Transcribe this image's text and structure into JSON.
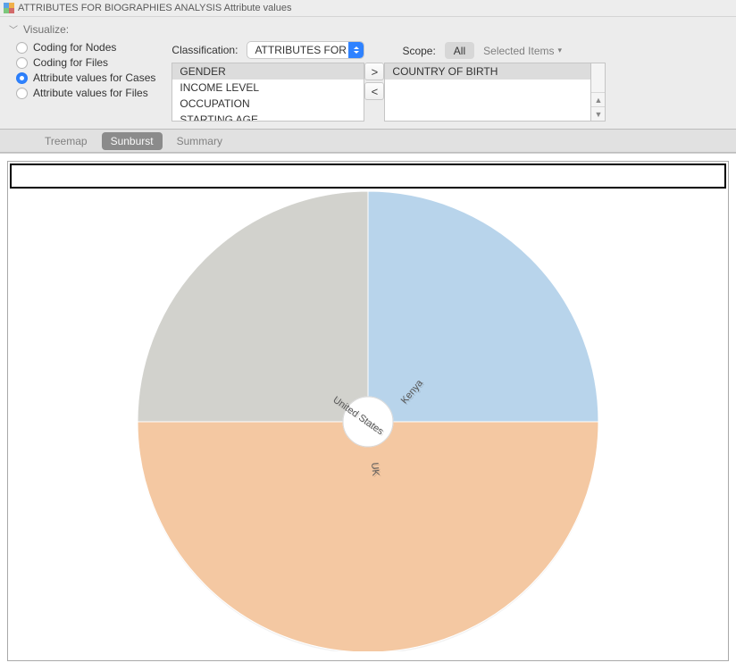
{
  "title": "ATTRIBUTES FOR BIOGRAPHIES ANALYSIS Attribute values",
  "visualize_label": "Visualize:",
  "radio_options": {
    "coding_nodes": "Coding for Nodes",
    "coding_files": "Coding for Files",
    "attr_cases": "Attribute values for Cases",
    "attr_files": "Attribute values for Files"
  },
  "radio_selected": "attr_cases",
  "classification_label": "Classification:",
  "classification_value": "ATTRIBUTES FOR B...",
  "attribute_list": [
    "GENDER",
    "INCOME LEVEL",
    "OCCUPATION",
    "STARTING AGE"
  ],
  "attribute_selected": "GENDER",
  "transfer_right": ">",
  "transfer_left": "<",
  "selected_attributes": [
    "COUNTRY OF BIRTH"
  ],
  "selected_attr_highlight": "COUNTRY OF BIRTH",
  "scope_label": "Scope:",
  "scope_all": "All",
  "scope_selected_items": "Selected Items",
  "tabs": {
    "treemap": "Treemap",
    "sunburst": "Sunburst",
    "summary": "Summary"
  },
  "active_tab": "sunburst",
  "chart_data": {
    "type": "pie",
    "title": "",
    "slices": [
      {
        "label": "Kenya",
        "value": 25,
        "color": "#b8d4eb",
        "startAngle": 0,
        "endAngle": 90,
        "labelAngle": 65,
        "labelRot": -50
      },
      {
        "label": "UK",
        "value": 50,
        "color": "#f4c8a2",
        "startAngle": 90,
        "endAngle": 270,
        "labelAngle": 175,
        "labelRot": 85
      },
      {
        "label": "United States",
        "value": 25,
        "color": "#d2d2cd",
        "startAngle": 270,
        "endAngle": 360,
        "labelAngle": 300,
        "labelRot": 35
      }
    ],
    "innerRadius": 28,
    "outerRadius": 258
  },
  "colors": {
    "accent": "#2f82ff"
  }
}
